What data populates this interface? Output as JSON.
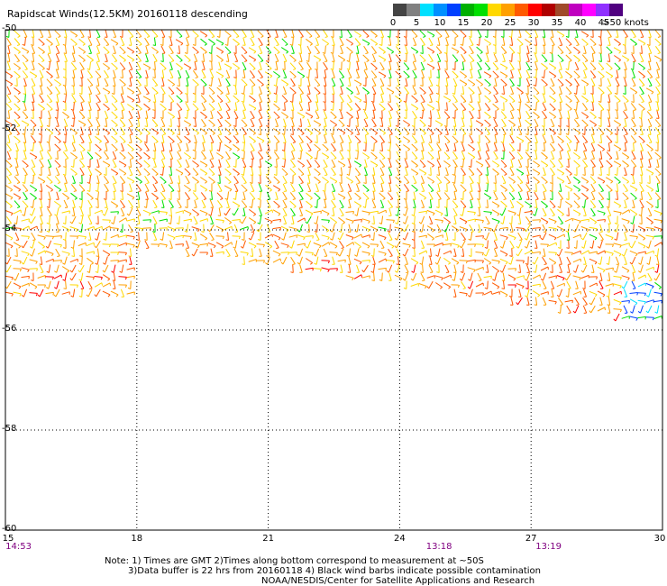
{
  "title": "Rapidscat Winds(12.5KM) 20160118 descending",
  "legend": {
    "colors": [
      "#444444",
      "#808080",
      "#00e0ff",
      "#0090ff",
      "#0040ff",
      "#00b000",
      "#00e000",
      "#ffd800",
      "#ffa000",
      "#ff5a00",
      "#ff0000",
      "#b00000",
      "#a04a2a",
      "#c000c0",
      "#ff00ff",
      "#9030ff",
      "#500080"
    ],
    "labels": [
      "0",
      "5",
      "10",
      "15",
      "20",
      "25",
      "30",
      "35",
      "40",
      "45",
      ">50 knots"
    ]
  },
  "axes": {
    "x_ticks": [
      "15",
      "18",
      "21",
      "24",
      "27",
      "30"
    ],
    "y_ticks": [
      "-50",
      "-52",
      "-54",
      "-56",
      "-58",
      "-60"
    ],
    "pass_times": [
      {
        "label": "14:53",
        "x": 15.3
      },
      {
        "label": "13:18",
        "x": 24.9
      },
      {
        "label": "13:19",
        "x": 27.4
      }
    ]
  },
  "chart_data": {
    "type": "wind-barb-map",
    "xlim": [
      15,
      30
    ],
    "ylim": [
      -60,
      -50
    ],
    "swaths": [
      {
        "name": "swath-west",
        "lon_range": [
          15,
          18
        ],
        "lat_range": [
          -55.3,
          -50
        ]
      },
      {
        "name": "swath-main",
        "lon_range": [
          18,
          30
        ],
        "lat_south_edge": [
          [
            18,
            -54.3
          ],
          [
            30,
            -55.9
          ]
        ],
        "lat_north": -50
      }
    ],
    "wind_speed_knots_by_latitude": [
      {
        "lat": -50.5,
        "speed": 25
      },
      {
        "lat": -52.0,
        "speed": 28
      },
      {
        "lat": -53.5,
        "speed": 24
      },
      {
        "lat": -55.0,
        "speed": 30
      }
    ],
    "calm_patch": {
      "lon": [
        29,
        30
      ],
      "lat": [
        -56,
        -55
      ],
      "speed": 12
    },
    "grid": true
  },
  "notes": [
    "Note: 1) Times are GMT 2)Times along bottom correspond to measurement at ~50S",
    "3)Data buffer is 22 hrs from 20160118 4) Black wind barbs indicate possible contamination",
    "NOAA/NESDIS/Center for Satellite Applications and Research"
  ]
}
